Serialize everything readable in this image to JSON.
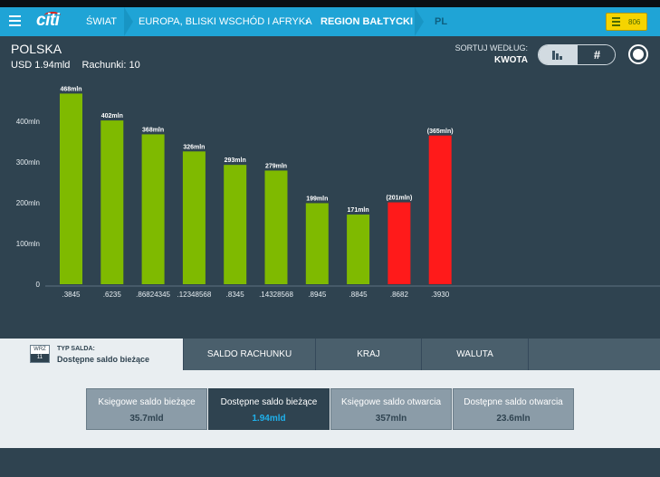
{
  "nav": {
    "logo": "citi",
    "crumbs": [
      "ŚWIAT",
      "EUROPA, BLISKI WSCHÓD I AFRYKA",
      "REGION BAŁTYCKI",
      "PL"
    ],
    "badge_count": "806"
  },
  "header": {
    "country": "POLSKA",
    "total": "USD 1.94mld",
    "accounts": "Rachunki: 10",
    "sort_label": "SORTUJ WEDŁUG:",
    "sort_value": "KWOTA",
    "hash_symbol": "#"
  },
  "colors": {
    "positive": "#7fba00",
    "negative": "#ff1a1a",
    "nav": "#1fa4d6",
    "background": "#2f4350"
  },
  "chart_data": {
    "type": "bar",
    "categories": [
      ".3845",
      ".6235",
      ".86824345",
      ".12348568",
      ".8345",
      ".14328568",
      ".8945",
      ".8845",
      ".8682",
      ".3930"
    ],
    "values": [
      468,
      402,
      368,
      326,
      293,
      279,
      199,
      171,
      -201,
      -365
    ],
    "value_labels": [
      "468mln",
      "402mln",
      "368mln",
      "326mln",
      "293mln",
      "279mln",
      "199mln",
      "171mln",
      "(201mln)",
      "(365mln)"
    ],
    "ylim": [
      0,
      480
    ],
    "yticks": [
      0,
      100,
      200,
      300,
      400
    ],
    "ytick_labels": [
      "0",
      "100mln",
      "200mln",
      "300mln",
      "400mln"
    ],
    "grid": false
  },
  "tabs": {
    "type_icon_top": "WRZ",
    "type_icon_bottom": "11",
    "type_title": "TYP SALDA:",
    "type_value": "Dostępne saldo bieżące",
    "items": [
      "SALDO RACHUNKU",
      "KRAJ",
      "WALUTA"
    ]
  },
  "cards": [
    {
      "label": "Księgowe saldo bieżące",
      "value": "35.7mld"
    },
    {
      "label": "Dostępne saldo bieżące",
      "value": "1.94mld"
    },
    {
      "label": "Księgowe saldo otwarcia",
      "value": "357mln"
    },
    {
      "label": "Dostępne saldo otwarcia",
      "value": "23.6mln"
    }
  ]
}
